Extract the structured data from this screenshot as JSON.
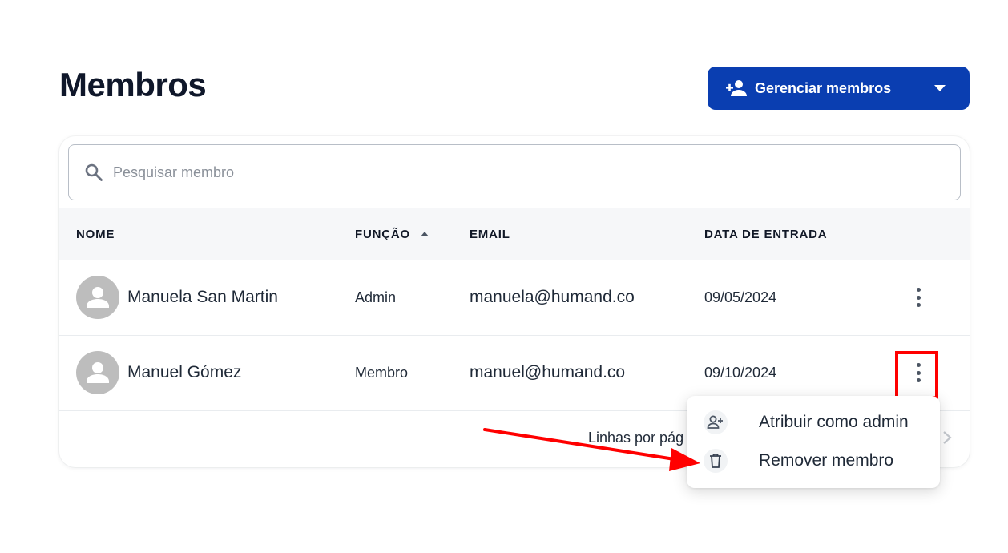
{
  "page": {
    "title": "Membros"
  },
  "actions": {
    "manage_label": "Gerenciar membros"
  },
  "search": {
    "placeholder": "Pesquisar membro",
    "value": ""
  },
  "table": {
    "columns": [
      "NOME",
      "FUNÇÃO",
      "EMAIL",
      "DATA DE ENTRADA"
    ],
    "sorted_column": "FUNÇÃO",
    "sort_direction": "ascending",
    "rows": [
      {
        "name": "Manuela San Martin",
        "role": "Admin",
        "email": "manuela@humand.co",
        "joined": "09/05/2024"
      },
      {
        "name": "Manuel Gómez",
        "role": "Membro",
        "email": "manuel@humand.co",
        "joined": "09/10/2024"
      }
    ]
  },
  "pagination": {
    "rows_per_page_label": "Linhas por pág"
  },
  "row_menu": {
    "items": [
      {
        "label": "Atribuir como admin",
        "icon": "person-add-icon"
      },
      {
        "label": "Remover membro",
        "icon": "trash-icon"
      }
    ]
  },
  "colors": {
    "primary": "#0a3eb1",
    "annotation": "#ff0000",
    "header_bg": "#f6f7f9",
    "avatar": "#bdbdbd"
  }
}
